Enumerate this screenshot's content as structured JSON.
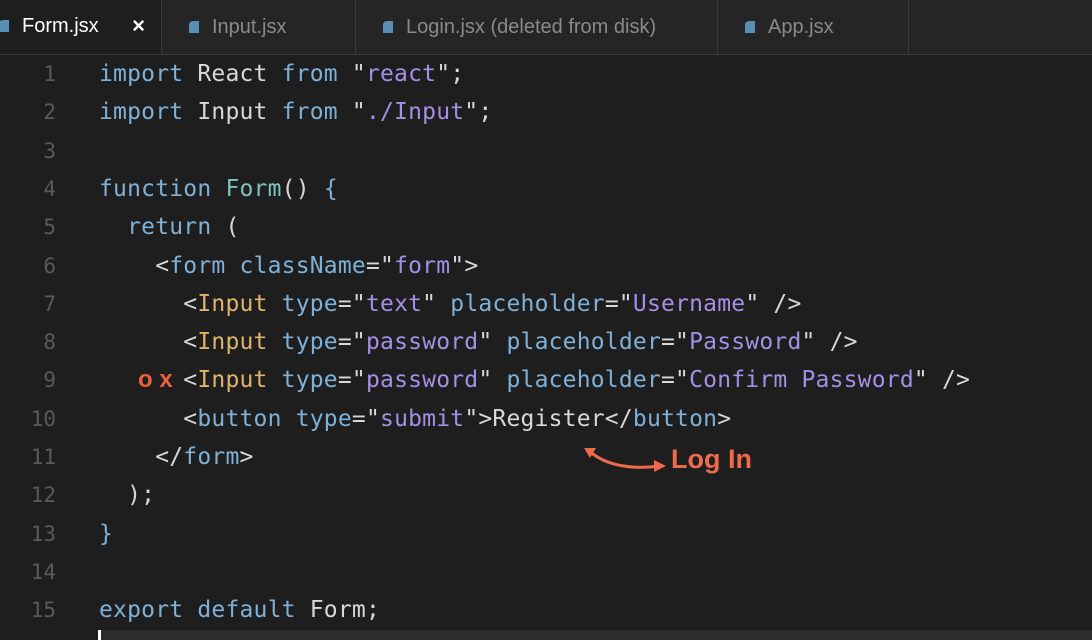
{
  "tabs": [
    {
      "label": "Form.jsx",
      "active": true,
      "close": "×"
    },
    {
      "label": "Input.jsx",
      "active": false
    },
    {
      "label": "Login.jsx (deleted from disk)",
      "active": false
    },
    {
      "label": "App.jsx",
      "active": false
    }
  ],
  "editor": {
    "line_numbers": [
      "1",
      "2",
      "3",
      "4",
      "5",
      "6",
      "7",
      "8",
      "9",
      "10",
      "11",
      "12",
      "13",
      "14",
      "15"
    ],
    "lines": [
      [
        {
          "t": "import",
          "c": "kw"
        },
        {
          "t": " React ",
          "c": "pl"
        },
        {
          "t": "from",
          "c": "kw"
        },
        {
          "t": " \"",
          "c": "pl"
        },
        {
          "t": "react",
          "c": "str"
        },
        {
          "t": "\";",
          "c": "pl"
        }
      ],
      [
        {
          "t": "import",
          "c": "kw"
        },
        {
          "t": " Input ",
          "c": "pl"
        },
        {
          "t": "from",
          "c": "kw"
        },
        {
          "t": " \"",
          "c": "pl"
        },
        {
          "t": "./Input",
          "c": "str"
        },
        {
          "t": "\";",
          "c": "pl"
        }
      ],
      [],
      [
        {
          "t": "function",
          "c": "kw"
        },
        {
          "t": " ",
          "c": "pl"
        },
        {
          "t": "Form",
          "c": "fn"
        },
        {
          "t": "() ",
          "c": "pl"
        },
        {
          "t": "{",
          "c": "kw"
        }
      ],
      [
        {
          "t": "  ",
          "c": "pl"
        },
        {
          "t": "return",
          "c": "kw"
        },
        {
          "t": " (",
          "c": "pl"
        }
      ],
      [
        {
          "t": "    <",
          "c": "pl"
        },
        {
          "t": "form",
          "c": "kw"
        },
        {
          "t": " ",
          "c": "pl"
        },
        {
          "t": "className",
          "c": "kw"
        },
        {
          "t": "=\"",
          "c": "pl"
        },
        {
          "t": "form",
          "c": "str"
        },
        {
          "t": "\">",
          "c": "pl"
        }
      ],
      [
        {
          "t": "      <",
          "c": "pl"
        },
        {
          "t": "Input",
          "c": "tag"
        },
        {
          "t": " ",
          "c": "pl"
        },
        {
          "t": "type",
          "c": "kw"
        },
        {
          "t": "=\"",
          "c": "pl"
        },
        {
          "t": "text",
          "c": "str"
        },
        {
          "t": "\" ",
          "c": "pl"
        },
        {
          "t": "placeholder",
          "c": "kw"
        },
        {
          "t": "=\"",
          "c": "pl"
        },
        {
          "t": "Username",
          "c": "str"
        },
        {
          "t": "\" />",
          "c": "pl"
        }
      ],
      [
        {
          "t": "      <",
          "c": "pl"
        },
        {
          "t": "Input",
          "c": "tag"
        },
        {
          "t": " ",
          "c": "pl"
        },
        {
          "t": "type",
          "c": "kw"
        },
        {
          "t": "=\"",
          "c": "pl"
        },
        {
          "t": "password",
          "c": "str"
        },
        {
          "t": "\" ",
          "c": "pl"
        },
        {
          "t": "placeholder",
          "c": "kw"
        },
        {
          "t": "=\"",
          "c": "pl"
        },
        {
          "t": "Password",
          "c": "str"
        },
        {
          "t": "\" />",
          "c": "pl"
        }
      ],
      [
        {
          "t": "      <",
          "c": "pl"
        },
        {
          "t": "Input",
          "c": "tag"
        },
        {
          "t": " ",
          "c": "pl"
        },
        {
          "t": "type",
          "c": "kw"
        },
        {
          "t": "=\"",
          "c": "pl"
        },
        {
          "t": "password",
          "c": "str"
        },
        {
          "t": "\" ",
          "c": "pl"
        },
        {
          "t": "placeholder",
          "c": "kw"
        },
        {
          "t": "=\"",
          "c": "pl"
        },
        {
          "t": "Confirm Password",
          "c": "str"
        },
        {
          "t": "\" />",
          "c": "pl"
        }
      ],
      [
        {
          "t": "      <",
          "c": "pl"
        },
        {
          "t": "button",
          "c": "kw"
        },
        {
          "t": " ",
          "c": "pl"
        },
        {
          "t": "type",
          "c": "kw"
        },
        {
          "t": "=\"",
          "c": "pl"
        },
        {
          "t": "submit",
          "c": "str"
        },
        {
          "t": "\">Register</",
          "c": "pl"
        },
        {
          "t": "button",
          "c": "kw"
        },
        {
          "t": ">",
          "c": "pl"
        }
      ],
      [
        {
          "t": "    </",
          "c": "pl"
        },
        {
          "t": "form",
          "c": "kw"
        },
        {
          "t": ">",
          "c": "pl"
        }
      ],
      [
        {
          "t": "  );",
          "c": "pl"
        }
      ],
      [
        {
          "t": "}",
          "c": "kw"
        }
      ],
      [],
      [
        {
          "t": "export",
          "c": "kw"
        },
        {
          "t": " ",
          "c": "pl"
        },
        {
          "t": "default",
          "c": "kw"
        },
        {
          "t": " Form;",
          "c": "pl"
        }
      ]
    ]
  },
  "annotations": {
    "line9_marks": "o x",
    "arrow_label": "Log In"
  },
  "colors": {
    "keyword": "#7fb1d8",
    "component": "#e0b36a",
    "string": "#a48fe6",
    "annotation": "#ee6a4c",
    "background": "#1e1e1e"
  }
}
